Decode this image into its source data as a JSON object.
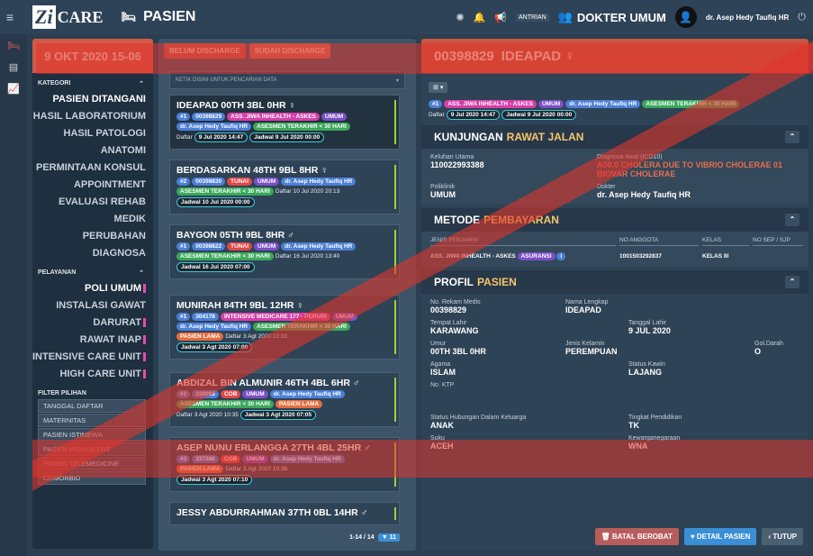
{
  "topbar": {
    "logo_mark": "Zi",
    "logo_text": "CARE",
    "module": "PASIEN",
    "antrian": "ANTRIAN",
    "dokter": "DOKTER UMUM",
    "user": "dr. Asep Hedy Taufiq HR"
  },
  "sidebar": {
    "date": "9 OKT 2020 15-06",
    "kategori": "KATEGORI",
    "kategori_items": [
      "PASIEN DITANGANI",
      "HASIL LABORATORIUM",
      "HASIL PATOLOGI ANATOMI",
      "PERMINTAAN KONSUL",
      "APPOINTMENT",
      "EVALUASI REHAB MEDIK",
      "PERUBAHAN DIAGNOSA"
    ],
    "pelayanan": "PELAYANAN",
    "pelayanan_items": [
      "POLI UMUM",
      "INSTALASI GAWAT DARURAT",
      "RAWAT INAP",
      "INTENSIVE CARE UNIT",
      "HIGH CARE UNIT"
    ],
    "filter": "FILTER PILIHAN",
    "filter_items": [
      "TANGGAL DAFTAR",
      "MATERNITAS",
      "PASIEN ISTIMEWA",
      "PASIEN HIGH-ALERT",
      "PASIEN TELEMEDICINE",
      "COMORBID"
    ]
  },
  "middle": {
    "tab_active": "BELUM DISCHARGE",
    "tab_other": "SUDAH DISCHARGE",
    "search_placeholder": "KETIK DISINI UNTUK PENCARIAN DATA",
    "patients": [
      {
        "name": "IDEAPAD 00TH 3BL 0HR ♀",
        "row1": [
          "#1",
          "00398829",
          "ASS. JIWA INHEALTH - ASKES",
          "UMUM"
        ],
        "row2": [
          "dr. Asep Hedy Taufiq HR",
          "ASESMEN TERAKHIR < 30 HARI"
        ],
        "daftar_label": "Daftar",
        "daftar": "9 Jul 2020 14:47",
        "jadwal_label": "Jadwal",
        "jadwal": "9 Jul 2020 00:00"
      },
      {
        "name": "BERDASARKAN 48TH 9BL 8HR ♀",
        "row1": [
          "#2",
          "00398830",
          "TUNAI",
          "UMUM",
          "dr. Asep Hedy Taufiq HR"
        ],
        "row2": [
          "ASESMEN TERAKHIR < 30 HARI"
        ],
        "daftar_label": "Daftar",
        "daftar": "10 Jul 2020 20:13",
        "jadwal_label": "Jadwal",
        "jadwal": "10 Jul 2020 00:00"
      },
      {
        "name": "BAYGON 05TH 9BL 8HR ♂",
        "row1": [
          "#1",
          "00398822",
          "TUNAI",
          "UMUM",
          "dr. Asep Hedy Taufiq HR"
        ],
        "row2": [
          "ASESMEN TERAKHIR < 30 HARI"
        ],
        "daftar_label": "Daftar",
        "daftar": "16 Jul 2020 13:40",
        "jadwal_label": "Jadwal",
        "jadwal": "16 Jul 2020 07:00"
      },
      {
        "name": "MUNIRAH 84TH 9BL 12HR ♀",
        "row1": [
          "#1",
          "304178",
          "INTENSIVE MEDICARE 177 - PERURI",
          "UMUM"
        ],
        "row2": [
          "dr. Asep Hedy Taufiq HR",
          "ASESMEN TERAKHIR < 30 HARI",
          "PASIEN LAMA"
        ],
        "daftar_label": "Daftar",
        "daftar": "3 Agt 2020 10:33",
        "jadwal_label": "Jadwal",
        "jadwal": "3 Agt 2020 07:00"
      },
      {
        "name": "ABDIZAL BIN ALMUNIR 46TH 4BL 6HR ♂",
        "row1": [
          "#2",
          "338993",
          "COB",
          "UMUM",
          "dr. Asep Hedy Taufiq HR"
        ],
        "row2": [
          "ASESMEN TERAKHIR < 30 HARI",
          "PASIEN LAMA"
        ],
        "daftar_label": "Daftar",
        "daftar": "3 Agt 2020 10:35",
        "jadwal_label": "Jadwal",
        "jadwal": "3 Agt 2020 07:05"
      },
      {
        "name": "ASEP NUNU ERLANGGA 27TH 4BL 25HR ♂",
        "row1": [
          "#3",
          "337386",
          "COB",
          "UMUM",
          "dr. Asep Hedy Taufiq HR"
        ],
        "row2": [
          "PASIEN LAMA"
        ],
        "daftar_label": "Daftar",
        "daftar": "3 Agt 2020 10:36",
        "jadwal_label": "Jadwal",
        "jadwal": "3 Agt 2020 07:10"
      },
      {
        "name": "JESSY ABDURRAHMAN 37TH 0BL 14HR ♂"
      }
    ],
    "pager": "1-14 / 14",
    "filter_count": "11"
  },
  "right": {
    "header_id": "00398829",
    "header_name": "IDEAPAD ♀",
    "tags": [
      "#1",
      "ASS. JIWA INHEALTH - ASKES",
      "UMUM",
      "dr. Asep Hedy Taufiq HR",
      "ASESMEN TERAKHIR < 30 HARI"
    ],
    "daftar_label": "Daftar",
    "daftar": "9 Jul 2020 14:47",
    "jadwal_label": "Jadwal",
    "jadwal": "9 Jul 2020 00:00",
    "kunjungan_a": "KUNJUNGAN",
    "kunjungan_b": "RAWAT JALAN",
    "keluhan_label": "Keluhan Utama",
    "keluhan": "110022993388",
    "diagnosa_label": "Diagnosa Awal (ICD10)",
    "diagnosa": "A00.0 CHOLERA DUE TO VIBRIO CHOLERAE 01 BIOVAR CHOLERAE",
    "poliklinik_label": "Poliklinik",
    "poliklinik": "UMUM",
    "dokter_label": "Dokter",
    "dokter": "dr. Asep Hedy Taufiq HR",
    "metode_a": "METODE",
    "metode_b": "PEMBAYARAN",
    "pay_cols": [
      "JENIS PENJAMIN",
      "NO ANGGOTA",
      "KELAS",
      "NO SEP / SJP"
    ],
    "pay_jenis": "ASS. JIWA INHEALTH - ASKES",
    "pay_tag": "ASURANSI",
    "pay_no": "1001503292837",
    "pay_kelas": "KELAS III",
    "profil_a": "PROFIL",
    "profil_b": "PASIEN",
    "profil": {
      "rm_label": "No. Rekam Medis",
      "rm": "00398829",
      "nama_label": "Nama Lengkap",
      "nama": "IDEAPAD",
      "tempat_label": "Tempat Lahir",
      "tempat": "KARAWANG",
      "tgl_label": "Tanggal Lahir",
      "tgl": "9 JUL 2020",
      "umur_label": "Umur",
      "umur": "00TH 3BL 0HR",
      "jk_label": "Jenis Kelamin",
      "jk": "PEREMPUAN",
      "gol_label": "Gol.Darah",
      "gol": "O",
      "agama_label": "Agama",
      "agama": "ISLAM",
      "kawin_label": "Status Kawin",
      "kawin": "LAJANG",
      "ktp_label": "No. KTP",
      "hub_label": "Status Hubungan Dalam Keluarga",
      "hub": "ANAK",
      "pend_label": "Tingkat Pendidikan",
      "pend": "TK",
      "suku_label": "Suku",
      "suku": "ACEH",
      "warga_label": "Kewarganegaraan",
      "warga": "WNA"
    },
    "btn_batal": "BATAL BEROBAT",
    "btn_detail": "DETAIL PASIEN",
    "btn_tutup": "TUTUP"
  },
  "colors": {
    "overlay": "#e0352b",
    "accent": "#3b8fd6"
  }
}
